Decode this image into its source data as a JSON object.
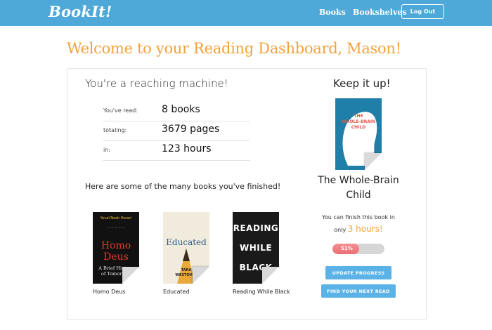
{
  "nav": {
    "brand": "BookIt!",
    "links": [
      "Books",
      "Bookshelves"
    ],
    "logout": "Log Out"
  },
  "welcome": "Welcome to your Reading Dashboard, Mason!",
  "stats": {
    "heading": "You're a reaching machine!",
    "rows": [
      {
        "label": "You've read:",
        "value": "8 books"
      },
      {
        "label": "totaling:",
        "value": "3679 pages"
      },
      {
        "label": "in:",
        "value": "123 hours"
      }
    ]
  },
  "finished": {
    "heading": "Here are some of the many books you've finished!",
    "books": [
      {
        "title": "Homo Deus",
        "cover_lines": [
          "Yuval Noah Harari",
          "Homo",
          "Deus",
          "A Brief History",
          "of Tomorrow"
        ]
      },
      {
        "title": "Educated",
        "cover_lines": [
          "Educated",
          "TARA",
          "WESTOVER"
        ]
      },
      {
        "title": "Reading While Black",
        "cover_lines": [
          "READING",
          "WHILE",
          "BLACK"
        ]
      }
    ]
  },
  "current": {
    "heading": "Keep it up!",
    "title": "The Whole-Brain Child",
    "cover_lines": [
      "THE",
      "WHOLE-BRAIN",
      "CHILD"
    ],
    "finish_text": "You can finish this book in",
    "only": "only",
    "hours": "3 hours!",
    "progress": 0.51,
    "progress_label": "51%",
    "update_button": "UPDATE PROGRESS",
    "next_button": "FIND YOUR NEXT READ"
  },
  "colors": {
    "nav": "#4ea8d8",
    "accent": "#f3a23a",
    "button": "#5ab2e6",
    "progress": "#ea6f75"
  }
}
